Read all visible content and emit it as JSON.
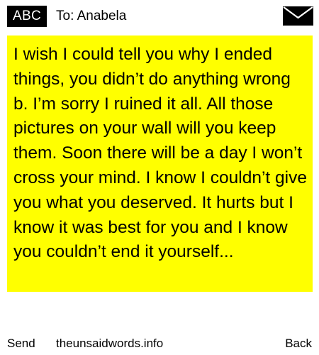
{
  "header": {
    "mode": "ABC",
    "recipient": "To: Anabela",
    "icon": "envelope-icon"
  },
  "message": {
    "text": "I wish I could tell you why I ended things, you didn’t do anything wrong b. I’m sorry I ruined it all. All those pictures on your wall will you keep them. Soon there will be a day I won’t cross your mind. I know I couldn’t give you what you deserved. It hurts but I know it was best for you and I know you couldn’t end it yourself..."
  },
  "footer": {
    "send_label": "Send",
    "site": "theunsaidwords.info",
    "back_label": "Back"
  },
  "colors": {
    "message_background": "#ffff00",
    "badge_background": "#000000",
    "page_background": "#ffffff"
  }
}
